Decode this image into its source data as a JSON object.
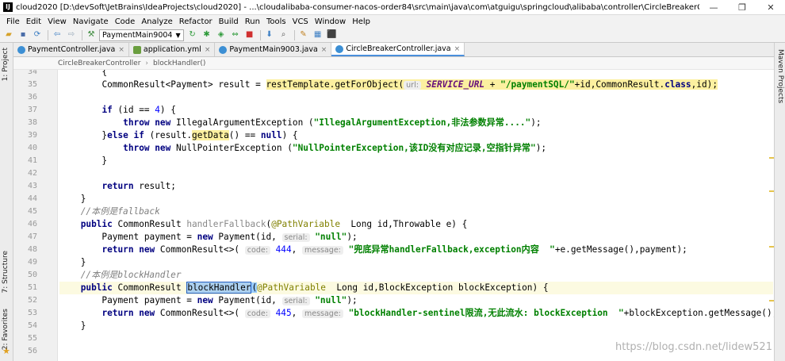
{
  "window": {
    "title": "cloud2020 [D:\\devSoft\\JetBrains\\IdeaProjects\\cloud2020] - ...\\cloudalibaba-consumer-nacos-order84\\src\\main\\java\\com\\atguigu\\springcloud\\alibaba\\controller\\CircleBreakerController.java [cloudalibaba-c...",
    "controls": [
      "—",
      "❐",
      "✕"
    ]
  },
  "menu": [
    "File",
    "Edit",
    "View",
    "Navigate",
    "Code",
    "Analyze",
    "Refactor",
    "Build",
    "Run",
    "Tools",
    "VCS",
    "Window",
    "Help"
  ],
  "toolbar": {
    "run_config": "PaymentMain9004"
  },
  "tabs": [
    {
      "label": "PaymentController.java",
      "active": false,
      "icon": "java-class-icon"
    },
    {
      "label": "application.yml",
      "active": false,
      "icon": "yaml-file-icon"
    },
    {
      "label": "PaymentMain9003.java",
      "active": false,
      "icon": "java-class-icon"
    },
    {
      "label": "CircleBreakerController.java",
      "active": true,
      "icon": "java-class-icon"
    }
  ],
  "breadcrumb": [
    "CircleBreakerController",
    "blockHandler()"
  ],
  "side_tabs": {
    "project": "1: Project",
    "structure": "7: Structure",
    "favorites": "2: Favorites",
    "maven": "Maven Projects"
  },
  "line_numbers": [
    "34",
    "35",
    "36",
    "37",
    "38",
    "39",
    "40",
    "41",
    "42",
    "43",
    "44",
    "45",
    "46",
    "47",
    "48",
    "49",
    "50",
    "51",
    "52",
    "53",
    "54",
    "55",
    "56"
  ],
  "code": {
    "l34": "        {",
    "l35_indent": "        ",
    "l35_a": "CommonResult<Payment> result = ",
    "l35_b": "restTemplate.getForObject(",
    "l35_hint": "url:",
    "l35_c": " SERVICE_URL",
    "l35_d": " + ",
    "l35_e": "\"/paymentSQL/\"",
    "l35_f": "+id,CommonResult.",
    "l35_g": "class",
    "l35_h": ",id);",
    "l37_a": "        ",
    "l37_kw": "if",
    "l37_b": " (id == ",
    "l37_num": "4",
    "l37_c": ") {",
    "l38_a": "            ",
    "l38_kw1": "throw",
    "l38_kw2": " new",
    "l38_b": " IllegalArgumentException (",
    "l38_str": "\"IllegalArgumentException,非法参数异常....\"",
    "l38_c": ");",
    "l39_a": "        }",
    "l39_kw1": "else if",
    "l39_b": " (result.",
    "l39_meth": "getData",
    "l39_c": "() == ",
    "l39_kw2": "null",
    "l39_d": ") {",
    "l40_a": "            ",
    "l40_kw1": "throw",
    "l40_kw2": " new",
    "l40_b": " NullPointerException (",
    "l40_str": "\"NullPointerException,该ID没有对应记录,空指针异常\"",
    "l40_c": ");",
    "l41": "        }",
    "l43_a": "        ",
    "l43_kw": "return",
    "l43_b": " result;",
    "l44": "    }",
    "l45": "    //本例是fallback",
    "l46_a": "    ",
    "l46_kw": "public",
    "l46_b": " CommonResult ",
    "l46_c": "handlerFallback",
    "l46_d": "(",
    "l46_an": "@PathVariable",
    "l46_e": "  Long id,Throwable e) {",
    "l47_a": "        Payment payment = ",
    "l47_kw": "new",
    "l47_b": " Payment(id, ",
    "l47_hint": "serial:",
    "l47_str": " \"null\"",
    "l47_c": ");",
    "l48_a": "        ",
    "l48_kw1": "return",
    "l48_kw2": " new",
    "l48_b": " CommonResult<>( ",
    "l48_hint1": "code:",
    "l48_num": " 444",
    "l48_c": ", ",
    "l48_hint2": "message:",
    "l48_str": " \"兜底异常handlerFallback,exception内容  \"",
    "l48_d": "+e.getMessage(),payment);",
    "l49": "    }",
    "l50": "    //本例是blockHandler",
    "l51_a": "    ",
    "l51_kw": "public",
    "l51_b": " CommonResult ",
    "l51_sel": "blockHandler",
    "l51_paren": "(",
    "l51_an": "@PathVariable",
    "l51_c": "  Long id,BlockException blockException) {",
    "l52_a": "        Payment payment = ",
    "l52_kw": "new",
    "l52_b": " Payment(id, ",
    "l52_hint": "serial:",
    "l52_str": " \"null\"",
    "l52_c": ");",
    "l53_a": "        ",
    "l53_kw1": "return",
    "l53_kw2": " new",
    "l53_b": " CommonResult<>( ",
    "l53_hint1": "code:",
    "l53_num": " 445",
    "l53_c": ", ",
    "l53_hint2": "message:",
    "l53_str": " \"blockHandler-sentinel限流,无此流水: blockException  \"",
    "l53_d": "+blockException.getMessage(),payment);",
    "l54": "    }"
  },
  "watermark": "https://blog.csdn.net/lidew521"
}
